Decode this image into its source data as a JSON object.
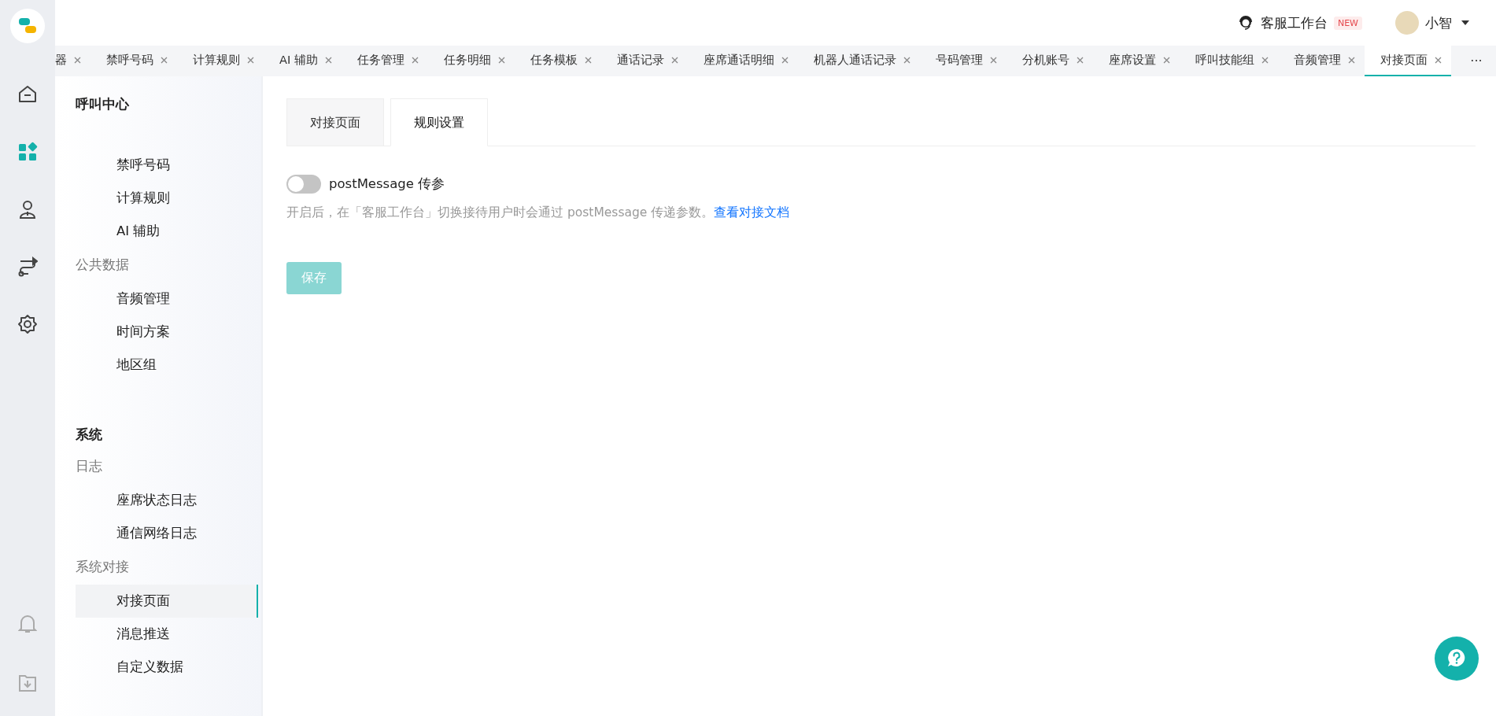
{
  "header": {
    "workbench": {
      "label": "客服工作台",
      "badge": "NEW"
    },
    "user": {
      "name": "小智"
    }
  },
  "rail": [
    {
      "kind": "home",
      "selected": false
    },
    {
      "kind": "apps",
      "selected": true
    },
    {
      "kind": "person",
      "selected": false
    },
    {
      "kind": "route",
      "selected": false
    },
    {
      "kind": "gear",
      "selected": false
    }
  ],
  "rail_bottom": [
    {
      "kind": "bell"
    },
    {
      "kind": "download"
    }
  ],
  "page_tabs": [
    {
      "label": "器",
      "selected": false
    },
    {
      "label": "禁呼号码",
      "selected": false
    },
    {
      "label": "计算规则",
      "selected": false
    },
    {
      "label": "AI 辅助",
      "selected": false
    },
    {
      "label": "任务管理",
      "selected": false
    },
    {
      "label": "任务明细",
      "selected": false
    },
    {
      "label": "任务模板",
      "selected": false
    },
    {
      "label": "通话记录",
      "selected": false
    },
    {
      "label": "座席通话明细",
      "selected": false
    },
    {
      "label": "机器人通话记录",
      "selected": false
    },
    {
      "label": "号码管理",
      "selected": false
    },
    {
      "label": "分机账号",
      "selected": false
    },
    {
      "label": "座席设置",
      "selected": false
    },
    {
      "label": "呼叫技能组",
      "selected": false
    },
    {
      "label": "音频管理",
      "selected": false
    },
    {
      "label": "对接页面",
      "selected": true
    }
  ],
  "more": "···",
  "sidebar": {
    "sections": [
      {
        "title": "呼叫中心",
        "groups": [
          {
            "items": [
              {
                "label": "禁呼号码",
                "selected": false
              },
              {
                "label": "计算规则",
                "selected": false
              },
              {
                "label": "AI 辅助",
                "selected": false
              }
            ]
          },
          {
            "title": "公共数据",
            "items": [
              {
                "label": "音频管理",
                "selected": false
              },
              {
                "label": "时间方案",
                "selected": false
              },
              {
                "label": "地区组",
                "selected": false
              }
            ]
          }
        ]
      },
      {
        "title": "系统",
        "groups": [
          {
            "title": "日志",
            "items": [
              {
                "label": "座席状态日志",
                "selected": false
              },
              {
                "label": "通信网络日志",
                "selected": false
              }
            ]
          },
          {
            "title": "系统对接",
            "items": [
              {
                "label": "对接页面",
                "selected": true
              },
              {
                "label": "消息推送",
                "selected": false
              },
              {
                "label": "自定义数据",
                "selected": false
              }
            ]
          }
        ]
      }
    ]
  },
  "content_tabs": [
    {
      "label": "对接页面",
      "selected": false
    },
    {
      "label": "规则设置",
      "selected": true
    }
  ],
  "setting": {
    "label": "postMessage 传参",
    "on": false,
    "description": "开启后，在「客服工作台」切换接待用户时会通过 postMessage 传递参数。",
    "link": "查看对接文档"
  },
  "save_button": {
    "label": "保存",
    "disabled": true
  }
}
